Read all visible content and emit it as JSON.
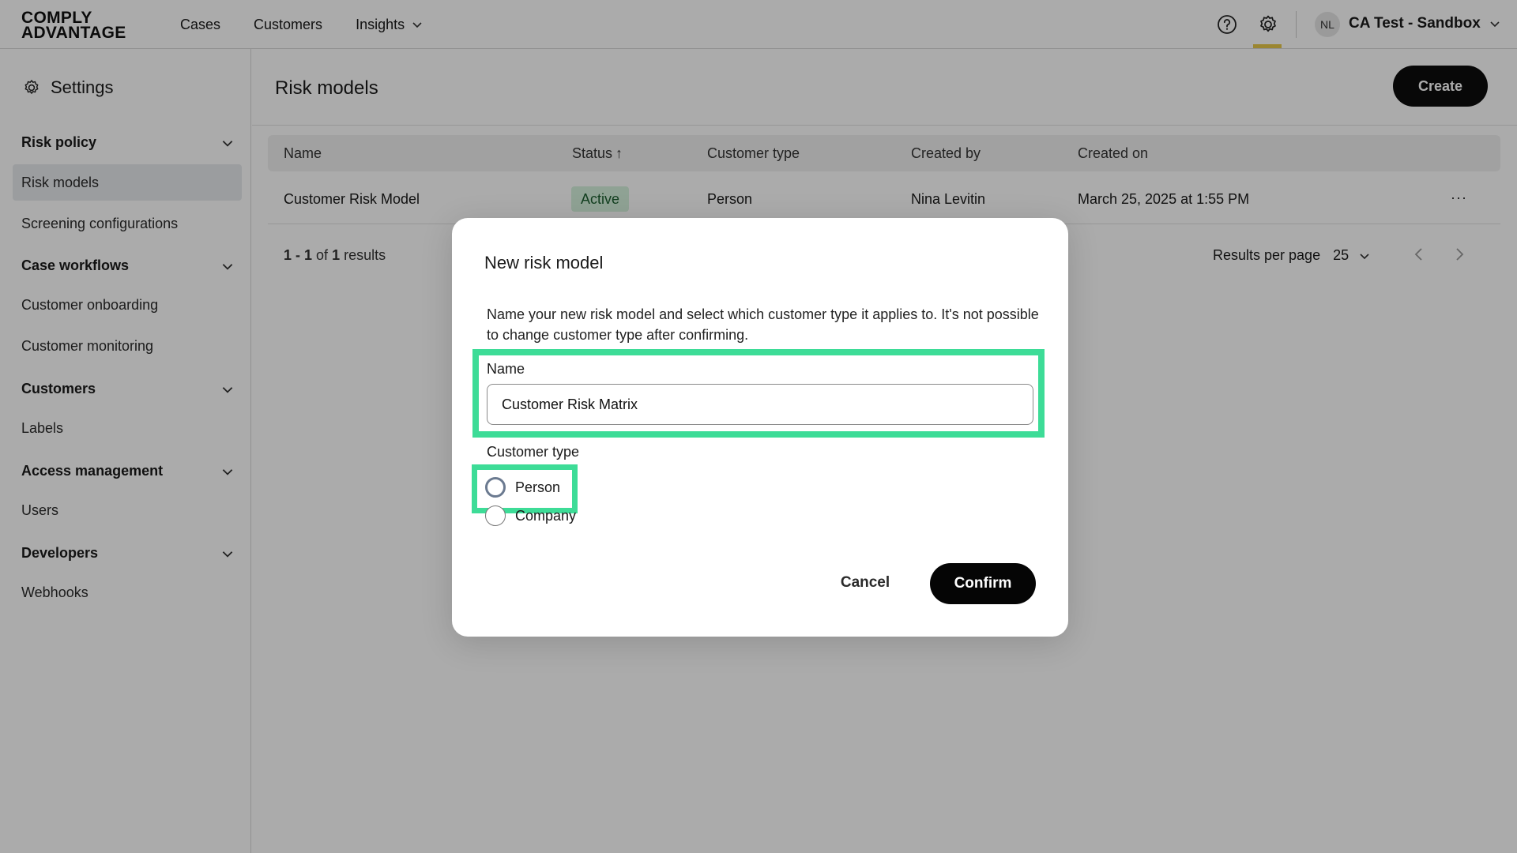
{
  "app": {
    "logo_line1": "COMPLY",
    "logo_line2": "ADVANTAGE",
    "nav": [
      {
        "label": "Cases"
      },
      {
        "label": "Customers"
      },
      {
        "label": "Insights"
      }
    ],
    "account": {
      "initials": "NL",
      "name": "CA Test - Sandbox"
    },
    "colors": {
      "accent_underline": "#e7c84a",
      "highlight_frame": "#3ddc97",
      "primary_button": "#0c0c0c",
      "active_badge_bg": "#d6f2dd"
    }
  },
  "sidebar": {
    "title": "Settings",
    "sections": [
      {
        "label": "Risk policy",
        "items": [
          {
            "label": "Risk models",
            "active": true
          },
          {
            "label": "Screening configurations"
          }
        ]
      },
      {
        "label": "Case workflows",
        "items": [
          {
            "label": "Customer onboarding"
          },
          {
            "label": "Customer monitoring"
          }
        ]
      },
      {
        "label": "Customers",
        "items": [
          {
            "label": "Labels"
          }
        ]
      },
      {
        "label": "Access management",
        "items": [
          {
            "label": "Users"
          }
        ]
      },
      {
        "label": "Developers",
        "items": [
          {
            "label": "Webhooks"
          }
        ]
      }
    ]
  },
  "main": {
    "title": "Risk models",
    "create_label": "Create",
    "columns": [
      "Name",
      "Status",
      "Customer type",
      "Created by",
      "Created on"
    ],
    "sort_indicator": "↑",
    "rows": [
      {
        "name": "Customer Risk Model",
        "status": "Active",
        "customer_type": "Person",
        "created_by": "Nina Levitin",
        "created_on": "March 25, 2025 at 1:55 PM",
        "menu": "···"
      }
    ],
    "results": {
      "range": "1 - 1",
      "of_label": "of",
      "total": "1",
      "suffix": "results"
    },
    "per_page_label": "Results per page",
    "per_page_value": "25"
  },
  "modal": {
    "title": "New risk model",
    "description": "Name your new risk model and select which customer type it applies to. It's not possible to change customer type after confirming.",
    "name_label": "Name",
    "name_value": "Customer Risk Matrix",
    "customer_type_label": "Customer type",
    "options": [
      {
        "label": "Person",
        "selected": false
      },
      {
        "label": "Company",
        "selected": false
      }
    ],
    "cancel_label": "Cancel",
    "confirm_label": "Confirm"
  }
}
